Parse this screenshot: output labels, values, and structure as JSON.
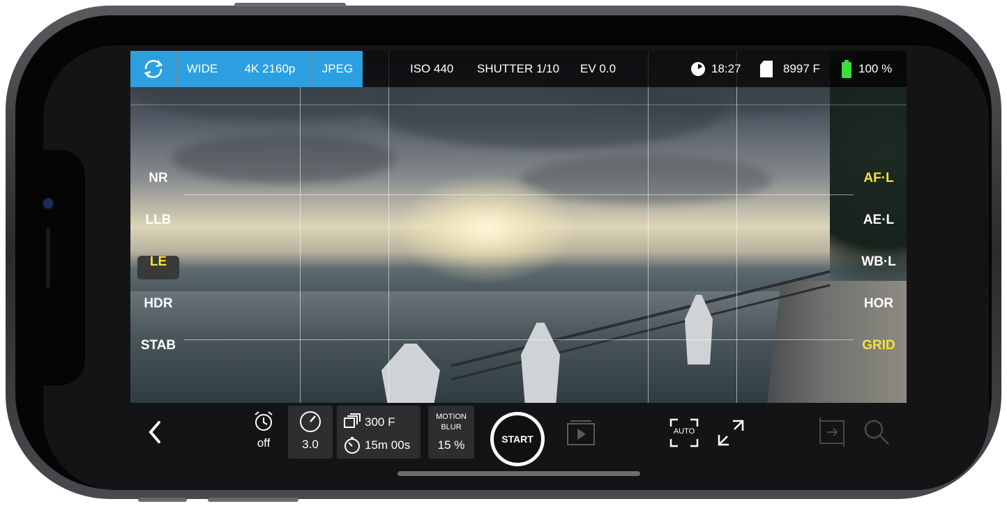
{
  "topbar": {
    "switch_icon": "rotate-arrows-icon",
    "lens": "WIDE",
    "resolution": "4K  2160p",
    "format": "JPEG",
    "iso": "ISO  440",
    "shutter": "SHUTTER 1/10",
    "ev": "EV  0.0",
    "time": "18:27",
    "frames": "8997 F",
    "battery": "100 %",
    "colors": {
      "accent_blue": "#2b9fe0",
      "battery_green": "#3ddc3d"
    }
  },
  "left_modes": [
    {
      "label": "NR",
      "active": false
    },
    {
      "label": "LLB",
      "active": false
    },
    {
      "label": "LE",
      "active": true
    },
    {
      "label": "HDR",
      "active": false
    },
    {
      "label": "STAB",
      "active": false
    }
  ],
  "right_modes": [
    {
      "label": "AF·L",
      "active": true
    },
    {
      "label": "AE·L",
      "active": false
    },
    {
      "label": "WB·L",
      "active": false
    },
    {
      "label": "HOR",
      "active": false
    },
    {
      "label": "GRID",
      "active": true
    }
  ],
  "bottombar": {
    "back_icon": "chevron-left-icon",
    "timer_value": "off",
    "speed_value": "3.0",
    "frames_value": "300 F",
    "duration_value": "15m 00s",
    "motion_blur_label_1": "MOTION",
    "motion_blur_label_2": "BLUR",
    "motion_blur_value": "15 %",
    "start_label": "START",
    "auto_label": "AUTO",
    "colors": {
      "active_yellow": "#f5e23a"
    }
  }
}
